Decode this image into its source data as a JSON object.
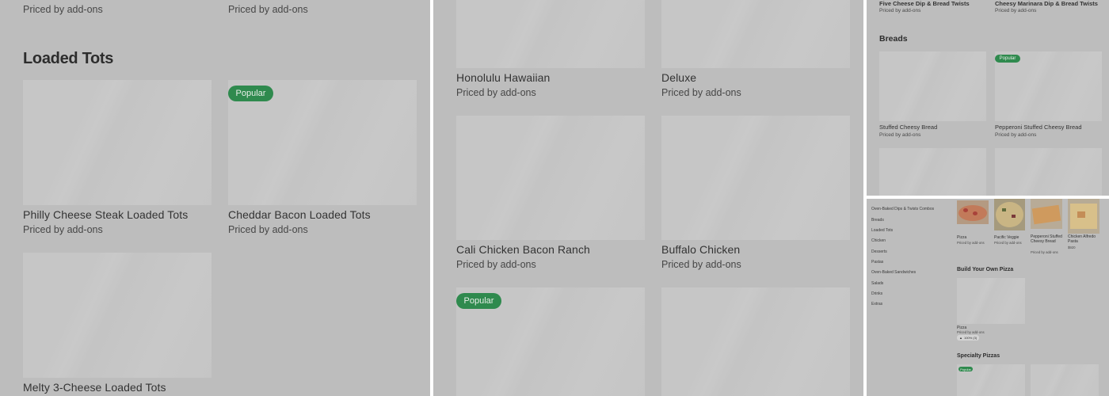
{
  "panel1": {
    "top_prices": [
      "Priced by add-ons",
      "Priced by add-ons"
    ],
    "section_title": "Loaded Tots",
    "items": [
      {
        "name": "Philly Cheese Steak Loaded Tots",
        "price": "Priced by add-ons"
      },
      {
        "name": "Cheddar Bacon Loaded Tots",
        "price": "Priced by add-ons",
        "badge": "Popular"
      },
      {
        "name": "Melty 3-Cheese Loaded Tots"
      }
    ]
  },
  "panel2": {
    "items": [
      {
        "name": "Honolulu Hawaiian",
        "price": "Priced by add-ons"
      },
      {
        "name": "Deluxe",
        "price": "Priced by add-ons"
      },
      {
        "name": "Cali Chicken Bacon Ranch",
        "price": "Priced by add-ons"
      },
      {
        "name": "Buffalo Chicken",
        "price": "Priced by add-ons"
      }
    ],
    "badge": "Popular"
  },
  "panel3": {
    "top_items": [
      {
        "name": "Five Cheese Dip & Bread Twists",
        "price": "Priced by add-ons"
      },
      {
        "name": "Cheesy Marinara Dip & Bread Twists",
        "price": "Priced by add-ons"
      }
    ],
    "section_title": "Breads",
    "items": [
      {
        "name": "Stuffed Cheesy Bread",
        "price": "Priced by add-ons"
      },
      {
        "name": "Pepperoni Stuffed Cheesy Bread",
        "price": "Priced by add-ons",
        "badge": "Popular"
      }
    ]
  },
  "panel4": {
    "nav": [
      "Oven-Baked Dips & Twists Combos",
      "Breads",
      "Loaded Tots",
      "Chicken",
      "Desserts",
      "Pastas",
      "Oven-Baked Sandwiches",
      "Salads",
      "Drinks",
      "Extras"
    ],
    "top_items": [
      {
        "name": "Pizza",
        "price": "Priced by add-ons"
      },
      {
        "name": "Pacific Veggie",
        "price": "Priced by add-ons"
      },
      {
        "name": "Pepperoni Stuffed Cheesy Bread",
        "price": "Priced by add-ons"
      },
      {
        "name": "Chicken Alfredo Pasta",
        "price": "$920"
      }
    ],
    "byo_title": "Build Your Own Pizza",
    "byo_item": {
      "name": "Pizza",
      "price": "Priced by add-ons",
      "rating": "100% (3)"
    },
    "specialty_title": "Specialty Pizzas",
    "badge": "Popular"
  },
  "colors": {
    "panel_bg": "#bdbdbd",
    "placeholder": "#c6c6c6",
    "badge": "#2f8a4e"
  },
  "icons": {
    "rating": "thumbs-up-icon"
  }
}
